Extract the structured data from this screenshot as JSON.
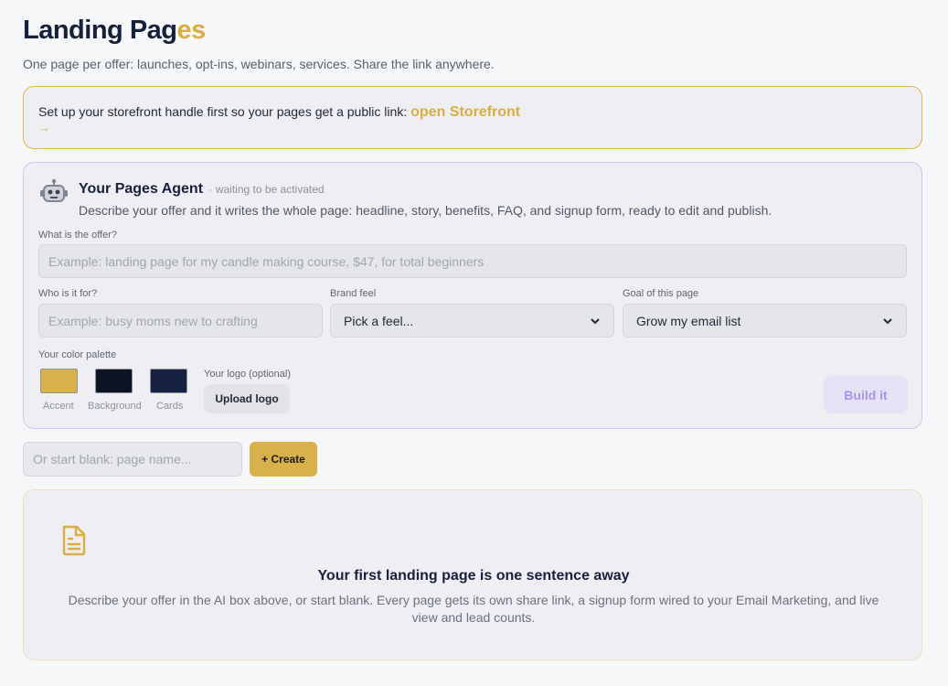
{
  "header": {
    "title_main": "Landing Pag",
    "title_accent": "es",
    "subtitle": "One page per offer: launches, opt-ins, webinars, services. Share the link anywhere."
  },
  "notice": {
    "text": "Set up your storefront handle first so your pages get a public link:",
    "link_label": "open Storefront",
    "arrow": "→"
  },
  "agent": {
    "icon": "robot-icon",
    "name": "Your Pages Agent",
    "status": "· waiting to be activated",
    "description": "Describe your offer and it writes the whole page: headline, story, benefits, FAQ, and signup form, ready to edit and publish.",
    "offer_label": "What is the offer?",
    "offer_placeholder": "Example: landing page for my candle making course, $47, for total beginners",
    "audience_label": "Who is it for?",
    "audience_placeholder": "Example: busy moms new to crafting",
    "brand_label": "Brand feel",
    "brand_value": "Pick a feel...",
    "goal_label": "Goal of this page",
    "goal_value": "Grow my email list",
    "palette_label": "Your color palette",
    "palette": [
      {
        "label": "Accent",
        "color": "#d8b14a"
      },
      {
        "label": "Background",
        "color": "#0c1322"
      },
      {
        "label": "Cards",
        "color": "#172240"
      }
    ],
    "logo_label": "Your logo (optional)",
    "upload_label": "Upload logo",
    "build_label": "Build it"
  },
  "blank": {
    "placeholder": "Or start blank: page name...",
    "create_label": "+ Create"
  },
  "empty_state": {
    "icon": "document-icon",
    "title": "Your first landing page is one sentence away",
    "description": "Describe your offer in the AI box above, or start blank. Every page gets its own share link, a signup form wired to your Email Marketing, and live view and lead counts."
  },
  "colors": {
    "accent": "#d7ae3f",
    "agent_border": "#c9c8f1",
    "build_button_text": "#a992ec"
  }
}
